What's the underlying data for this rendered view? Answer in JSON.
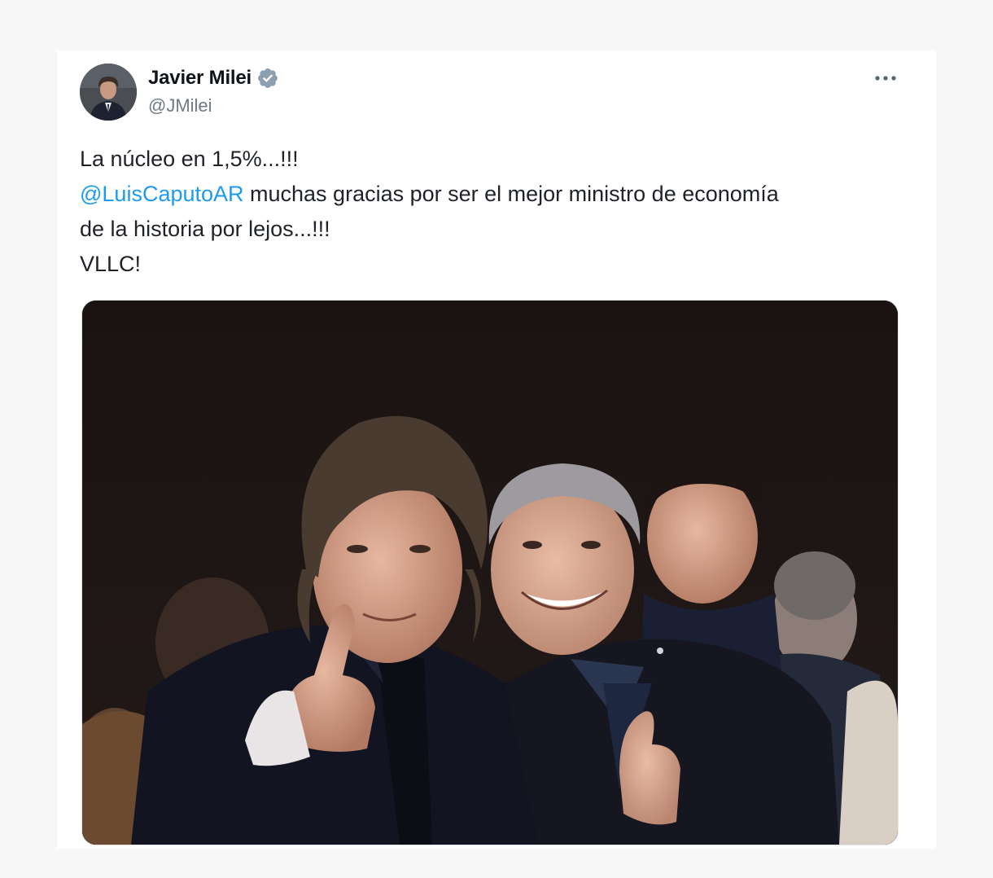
{
  "tweet": {
    "author": {
      "display_name": "Javier Milei",
      "handle": "@JMilei",
      "verified": true,
      "verified_icon": "verified-badge-icon",
      "verified_color": "#8c9fb0"
    },
    "more_icon": "more-horizontal-icon",
    "text": {
      "line1": "La núcleo en 1,5%...!!!",
      "mention": "@LuisCaputoAR",
      "line2_rest": " muchas gracias por ser el mejor ministro de economía",
      "line3": "de la historia por lejos...!!!",
      "line4": "VLLC!"
    },
    "mention_color": "#1d9bf0",
    "media": {
      "type": "photo"
    }
  }
}
